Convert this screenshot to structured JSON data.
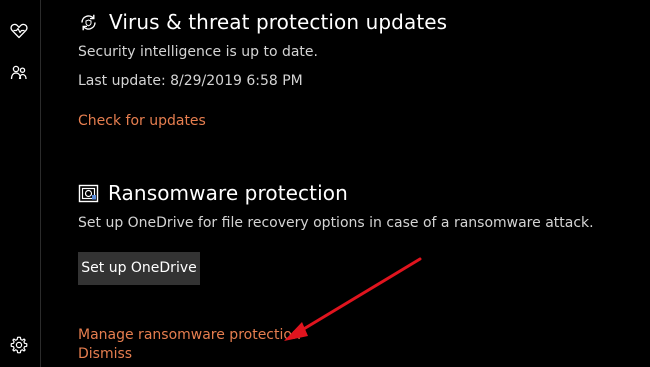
{
  "sidebar": {
    "icons": [
      "health-heart-icon",
      "family-options-icon",
      "settings-gear-icon"
    ]
  },
  "updates_section": {
    "title": "Virus & threat protection updates",
    "icon": "refresh-shield-icon",
    "status": "Security intelligence is up to date.",
    "last_update": "Last update: 8/29/2019 6:58 PM",
    "check_link": "Check for updates"
  },
  "ransomware_section": {
    "title": "Ransomware protection",
    "icon": "ransomware-folder-icon",
    "description": "Set up OneDrive for file recovery options in case of a ransomware attack.",
    "setup_button": "Set up OneDrive",
    "manage_link": "Manage ransomware protection",
    "dismiss_link": "Dismiss"
  },
  "colors": {
    "background": "#000000",
    "link": "#e67e4f",
    "button_bg": "#333333",
    "annotation_arrow": "#e0141e"
  }
}
